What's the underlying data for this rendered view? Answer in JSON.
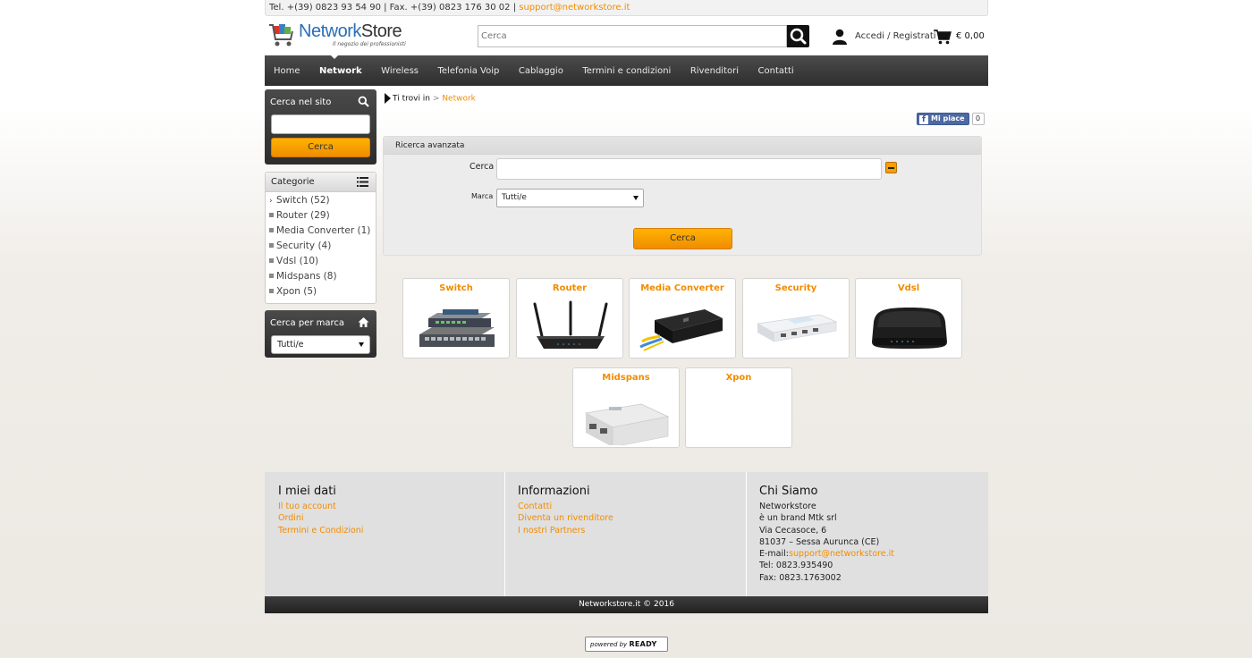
{
  "topbar": {
    "contacts": "Tel. +(39) 0823 93 54 90 | Fax. +(39) 0823 176 30 02 | ",
    "email": "support@networkstore.it"
  },
  "header": {
    "logo_part1": "Network",
    "logo_part2": "Store",
    "logo_tagline": "Il negozio dei professionisti",
    "search_placeholder": "Cerca",
    "login_label": "Accedi / Registrati",
    "cart_total": "€ 0,00"
  },
  "nav": {
    "items": [
      {
        "label": "Home"
      },
      {
        "label": "Network"
      },
      {
        "label": "Wireless"
      },
      {
        "label": "Telefonia Voip"
      },
      {
        "label": "Cablaggio"
      },
      {
        "label": "Termini e condizioni"
      },
      {
        "label": "Rivenditori"
      },
      {
        "label": "Contatti"
      }
    ],
    "active": "Network"
  },
  "sidebar": {
    "search_title": "Cerca nel sito",
    "search_button": "Cerca",
    "categories_title": "Categorie",
    "categories": [
      {
        "label": "Switch (52)"
      },
      {
        "label": "Router (29)"
      },
      {
        "label": "Media Converter (1)"
      },
      {
        "label": "Security (4)"
      },
      {
        "label": "Vdsl (10)"
      },
      {
        "label": "Midspans (8)"
      },
      {
        "label": "Xpon (5)"
      }
    ],
    "brand_title": "Cerca per marca",
    "brand_selected": "Tutti/e"
  },
  "breadcrumb": {
    "prefix": "Ti trovi in",
    "separator": ">",
    "current": "Network"
  },
  "facebook": {
    "like_label": "Mi piace",
    "count": "0"
  },
  "advanced_search": {
    "title": "Ricerca avanzata",
    "cerca_label": "Cerca",
    "marca_label": "Marca",
    "marca_selected": "Tutti/e",
    "button": "Cerca"
  },
  "products": [
    {
      "title": "Switch",
      "icon": "switch-image"
    },
    {
      "title": "Router",
      "icon": "router-image"
    },
    {
      "title": "Media Converter",
      "icon": "media-converter-image"
    },
    {
      "title": "Security",
      "icon": "security-image"
    },
    {
      "title": "Vdsl",
      "icon": "vdsl-image"
    },
    {
      "title": "Midspans",
      "icon": "midspan-image"
    },
    {
      "title": "Xpon",
      "icon": ""
    }
  ],
  "footer": {
    "col1": {
      "title": "I miei dati",
      "links": [
        "Il tuo account",
        "Ordini",
        "Termini e Condizioni"
      ]
    },
    "col2": {
      "title": "Informazioni",
      "links": [
        "Contatti",
        "Diventa un rivenditore",
        "I nostri Partners"
      ]
    },
    "col3": {
      "title": "Chi Siamo",
      "lines": [
        "Networkstore",
        "è un brand Mtk srl",
        "Via Cecasoce, 6",
        "81037 – Sessa Aurunca (CE)"
      ],
      "email_label": "E-mail:",
      "email": "support@networkstore.it",
      "tel": "Tel: 0823.935490",
      "fax": "Fax: 0823.1763002"
    },
    "copyright": "Networkstore.it © 2016"
  },
  "powered": {
    "prefix": "powered by",
    "brand": "READY"
  },
  "colors": {
    "accent": "#f28c00",
    "nav_bg": "#3a3a3a",
    "button": "#f5a000"
  }
}
